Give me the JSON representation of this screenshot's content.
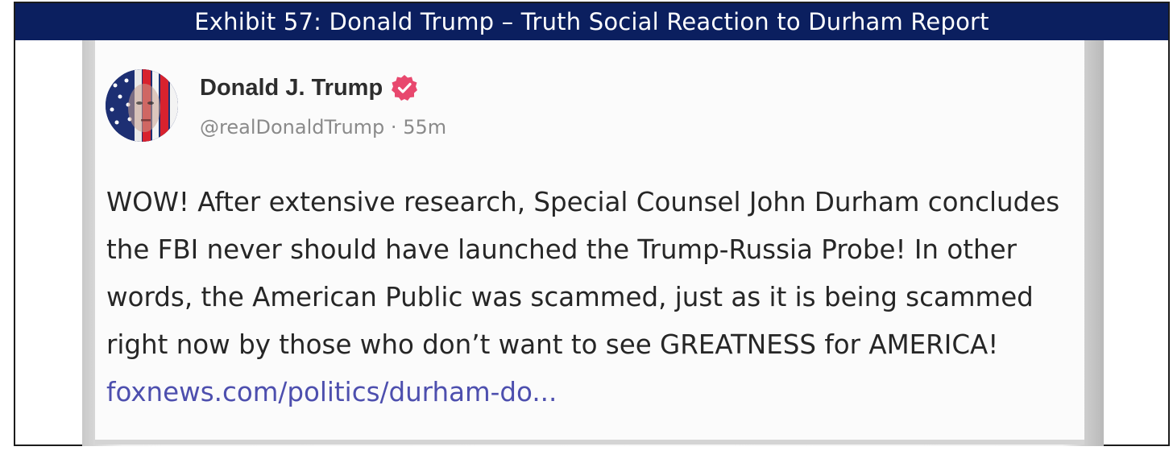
{
  "exhibit": {
    "title": "Exhibit 57: Donald Trump – Truth Social Reaction to Durham Report"
  },
  "post": {
    "author_name": "Donald J. Trump",
    "handle": "@realDonaldTrump",
    "separator": " · ",
    "time_ago": "55m",
    "body_text": "WOW! After extensive research, Special Counsel John Durham concludes the FBI never should have launched the Trump-Russia Probe! In other words, the American Public was scammed, just as it is being scammed right now by those who don’t want to see GREATNESS for AMERICA! ",
    "link_text": "foxnews.com/politics/durham-do..."
  },
  "icons": {
    "verified": "verified-badge-icon",
    "avatar": "avatar"
  },
  "colors": {
    "header_bg": "#0b1f5f",
    "verified_badge": "#e8486e",
    "link": "#4d4fae"
  }
}
